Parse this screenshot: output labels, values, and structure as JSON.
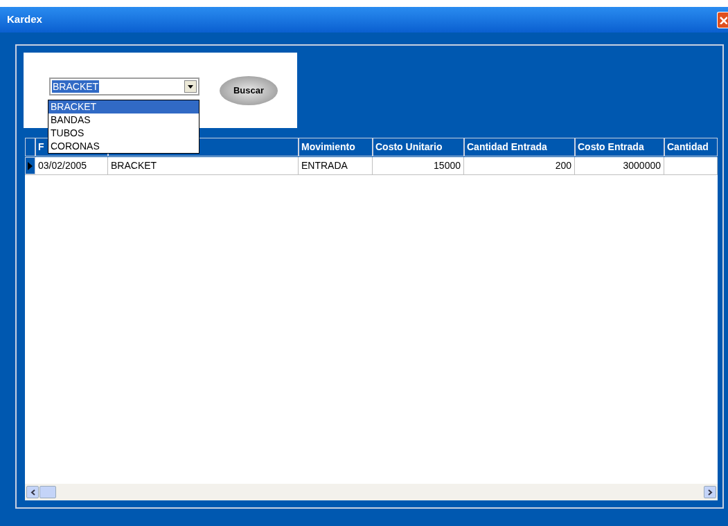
{
  "window": {
    "title": "Kardex"
  },
  "search": {
    "value": "BRACKET",
    "button": "Buscar",
    "options": [
      {
        "label": "BRACKET",
        "selected": true
      },
      {
        "label": "BANDAS",
        "selected": false
      },
      {
        "label": "TUBOS",
        "selected": false
      },
      {
        "label": "CORONAS",
        "selected": false
      }
    ]
  },
  "table": {
    "columns": [
      {
        "label": "F"
      },
      {},
      {
        "label": "Movimiento"
      },
      {
        "label": "Costo Unitario"
      },
      {
        "label": "Cantidad Entrada"
      },
      {
        "label": "Costo Entrada"
      },
      {
        "label": "Cantidad"
      }
    ],
    "rows": [
      {
        "selected": true,
        "cells": [
          "03/02/2005",
          "BRACKET",
          "ENTRADA",
          "15000",
          "200",
          "3000000"
        ]
      }
    ]
  }
}
